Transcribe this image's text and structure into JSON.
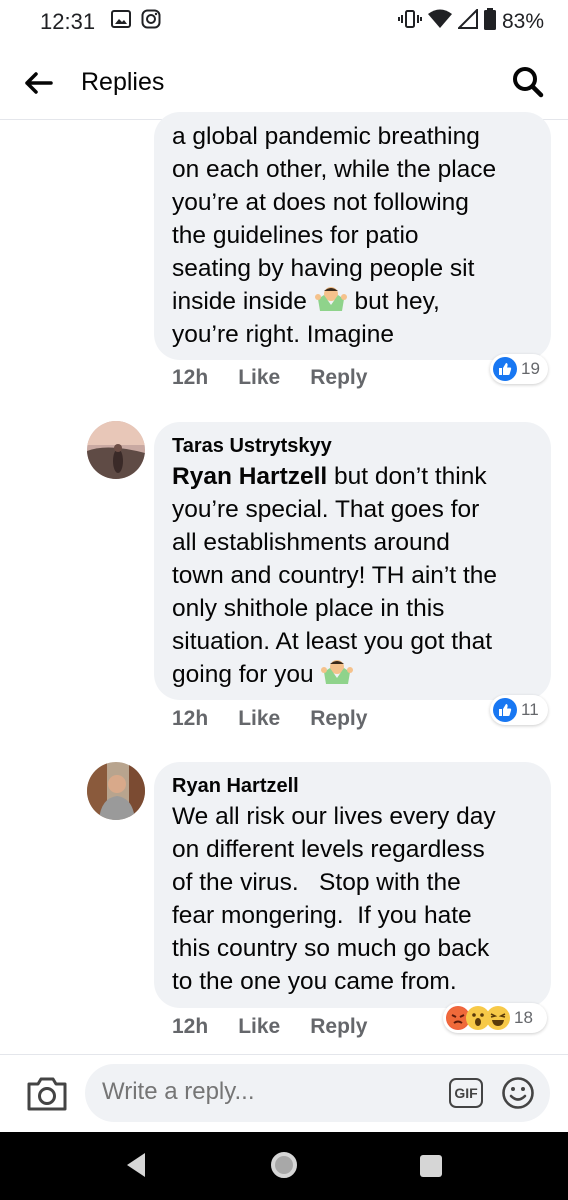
{
  "status_bar": {
    "time": "12:31",
    "battery": "83%",
    "icons": [
      "gallery-icon",
      "instagram-icon",
      "vibrate-icon",
      "wifi-icon",
      "signal-icon",
      "battery-icon"
    ]
  },
  "header": {
    "title": "Replies",
    "back_icon": "back-arrow-icon",
    "search_icon": "search-icon"
  },
  "comments": [
    {
      "author": "",
      "mention": "",
      "text_lines": [
        "a global pandemic breathing",
        "on each other, while the place",
        "you’re at does not following",
        "the guidelines for patio",
        "seating by having people sit",
        "inside inside",
        "you’re right. Imagine"
      ],
      "inline_after_line6": "but hey,",
      "time": "12h",
      "like_label": "Like",
      "reply_label": "Reply",
      "reaction_count": "19",
      "reactions": [
        "like-reaction-icon"
      ]
    },
    {
      "author": "Taras Ustrytskyy",
      "mention": "Ryan Hartzell",
      "text_lines": [
        "but don’t think",
        "you’re special. That goes for",
        "all establishments around",
        "town and country! TH ain’t the",
        "only shithole place in this",
        "situation. At least you got that",
        "going for you"
      ],
      "time": "12h",
      "like_label": "Like",
      "reply_label": "Reply",
      "reaction_count": "11",
      "reactions": [
        "like-reaction-icon"
      ]
    },
    {
      "author": "Ryan Hartzell",
      "mention": "",
      "text_lines": [
        "We all risk our lives every day",
        "on different levels regardless",
        "of the virus.   Stop with the",
        "fear mongering.  If you hate",
        "this country so much go back",
        "to the one you came from."
      ],
      "time": "12h",
      "like_label": "Like",
      "reply_label": "Reply",
      "reaction_count": "18",
      "reactions": [
        "angry-reaction-icon",
        "wow-reaction-icon",
        "haha-reaction-icon"
      ]
    }
  ],
  "composer": {
    "placeholder": "Write a reply...",
    "gif_label": "GIF"
  },
  "colors": {
    "bubble": "#f0f2f5",
    "meta_text": "#65676b",
    "like_blue": "#1877f2"
  }
}
